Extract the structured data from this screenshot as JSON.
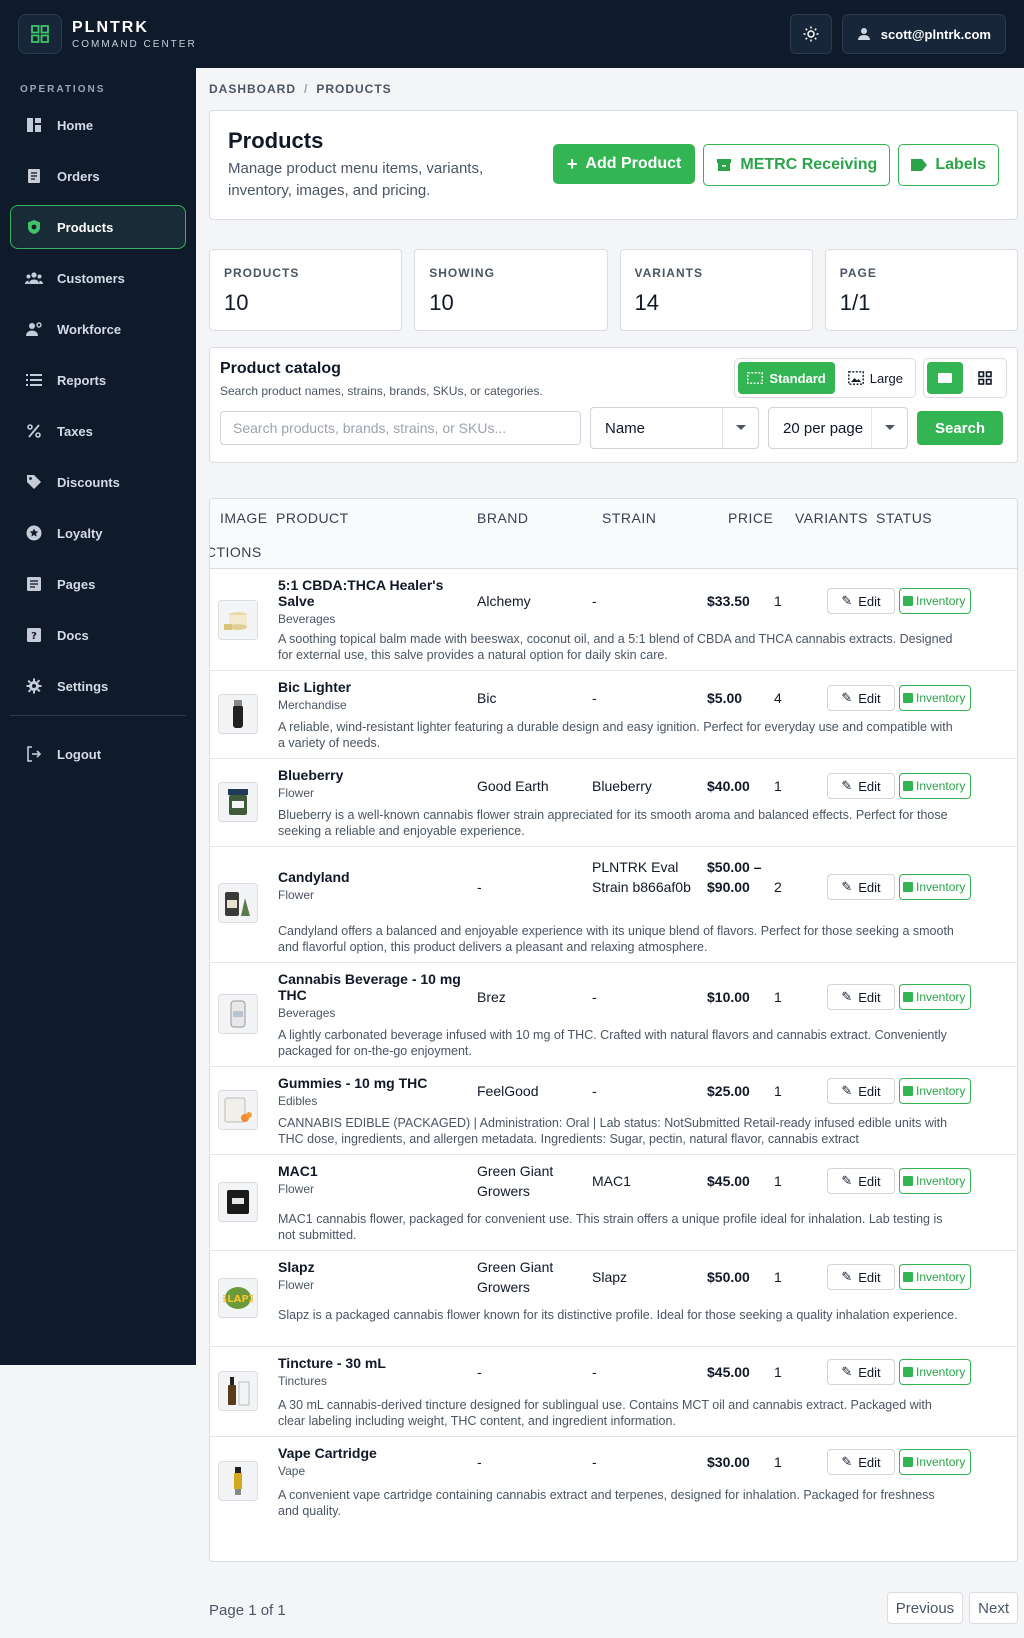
{
  "app": {
    "name": "PLNTRK",
    "subtitle": "COMMAND CENTER",
    "user_email": "scott@plntrk.com"
  },
  "sidebar": {
    "section": "OPERATIONS",
    "items": [
      {
        "label": "Home",
        "icon": "home-icon"
      },
      {
        "label": "Orders",
        "icon": "orders-icon"
      },
      {
        "label": "Products",
        "icon": "products-icon",
        "active": true
      },
      {
        "label": "Customers",
        "icon": "customers-icon"
      },
      {
        "label": "Workforce",
        "icon": "workforce-icon"
      },
      {
        "label": "Reports",
        "icon": "reports-icon"
      },
      {
        "label": "Taxes",
        "icon": "percent-icon"
      },
      {
        "label": "Discounts",
        "icon": "tag-icon"
      },
      {
        "label": "Loyalty",
        "icon": "star-icon"
      },
      {
        "label": "Pages",
        "icon": "pages-icon"
      },
      {
        "label": "Docs",
        "icon": "docs-icon"
      },
      {
        "label": "Settings",
        "icon": "gear-icon"
      }
    ],
    "logout": "Logout"
  },
  "breadcrumb": {
    "root": "DASHBOARD",
    "sep": "/",
    "current": "PRODUCTS"
  },
  "header": {
    "title": "Products",
    "description": "Manage product menu items, variants, inventory, images, and pricing.",
    "add_label": "Add Product",
    "metrc_label": "METRC Receiving",
    "labels_label": "Labels"
  },
  "stats": [
    {
      "label": "PRODUCTS",
      "value": "10"
    },
    {
      "label": "SHOWING",
      "value": "10"
    },
    {
      "label": "VARIANTS",
      "value": "14"
    },
    {
      "label": "PAGE",
      "value": "1/1"
    }
  ],
  "catalog": {
    "title": "Product catalog",
    "subtitle": "Search product names, strains, brands, SKUs, or categories.",
    "view_standard": "Standard",
    "view_large": "Large",
    "search_placeholder": "Search products, brands, strains, or SKUs...",
    "sort_value": "Name",
    "per_page_value": "20 per page",
    "search_button": "Search"
  },
  "table": {
    "columns": {
      "image": "IMAGE",
      "product": "PRODUCT",
      "brand": "BRAND",
      "strain": "STRAIN",
      "price": "PRICE",
      "variants": "VARIANTS",
      "status": "STATUS",
      "actions": "ACTIONS"
    },
    "edit_label": "Edit",
    "inventory_label": "Inventory",
    "rows": [
      {
        "name": "5:1 CBDA:THCA Healer's Salve",
        "category": "Beverages",
        "brand": "Alchemy",
        "strain": "-",
        "price": "$33.50",
        "variants": "1",
        "description": "A soothing topical balm made with beeswax, coconut oil, and a 5:1 blend of CBDA and THCA cannabis extracts. Designed for external use, this salve provides a natural option for daily skin care."
      },
      {
        "name": "Bic Lighter",
        "category": "Merchandise",
        "brand": "Bic",
        "strain": "-",
        "price": "$5.00",
        "variants": "4",
        "description": "A reliable, wind-resistant lighter featuring a durable design and easy ignition. Perfect for everyday use and compatible with a variety of needs."
      },
      {
        "name": "Blueberry",
        "category": "Flower",
        "brand": "Good Earth",
        "strain": "Blueberry",
        "price": "$40.00",
        "variants": "1",
        "description": "Blueberry is a well-known cannabis flower strain appreciated for its smooth aroma and balanced effects. Perfect for those seeking a reliable and enjoyable experience."
      },
      {
        "name": "Candyland",
        "category": "Flower",
        "brand": "-",
        "strain": "PLNTRK Eval Strain b866af0b",
        "price": "$50.00 – $90.00",
        "variants": "2",
        "description": "Candyland offers a balanced and enjoyable experience with its unique blend of flavors. Perfect for those seeking a smooth and flavorful option, this product delivers a pleasant and relaxing atmosphere."
      },
      {
        "name": "Cannabis Beverage - 10 mg THC",
        "category": "Beverages",
        "brand": "Brez",
        "strain": "-",
        "price": "$10.00",
        "variants": "1",
        "description": "A lightly carbonated beverage infused with 10 mg of THC. Crafted with natural flavors and cannabis extract. Conveniently packaged for on-the-go enjoyment."
      },
      {
        "name": "Gummies - 10 mg THC",
        "category": "Edibles",
        "brand": "FeelGood",
        "strain": "-",
        "price": "$25.00",
        "variants": "1",
        "description": "CANNABIS EDIBLE (PACKAGED) | Administration: Oral | Lab status: NotSubmitted Retail-ready infused edible units with THC dose, ingredients, and allergen metadata. Ingredients: Sugar, pectin, natural flavor, cannabis extract"
      },
      {
        "name": "MAC1",
        "category": "Flower",
        "brand": "Green Giant Growers",
        "strain": "MAC1",
        "price": "$45.00",
        "variants": "1",
        "description": "MAC1 cannabis flower, packaged for convenient use. This strain offers a unique profile ideal for inhalation. Lab testing is not submitted."
      },
      {
        "name": "Slapz",
        "category": "Flower",
        "brand": "Green Giant Growers",
        "strain": "Slapz",
        "price": "$50.00",
        "variants": "1",
        "description": "Slapz is a packaged cannabis flower known for its distinctive profile. Ideal for those seeking a quality inhalation experience."
      },
      {
        "name": "Tincture - 30 mL",
        "category": "Tinctures",
        "brand": "-",
        "strain": "-",
        "price": "$45.00",
        "variants": "1",
        "description": "A 30 mL cannabis-derived tincture designed for sublingual use. Contains MCT oil and cannabis extract. Packaged with clear labeling including weight, THC content, and ingredient information."
      },
      {
        "name": "Vape Cartridge",
        "category": "Vape",
        "brand": "-",
        "strain": "-",
        "price": "$30.00",
        "variants": "1",
        "description": "A convenient vape cartridge containing cannabis extract and terpenes, designed for inhalation. Packaged for freshness and quality."
      }
    ]
  },
  "pagination": {
    "label": "Page 1 of 1",
    "previous": "Previous",
    "next": "Next"
  },
  "colors": {
    "sidebar_bg": "#0f1a2b",
    "accent": "#32b552",
    "page_bg": "#f4f5f7"
  }
}
